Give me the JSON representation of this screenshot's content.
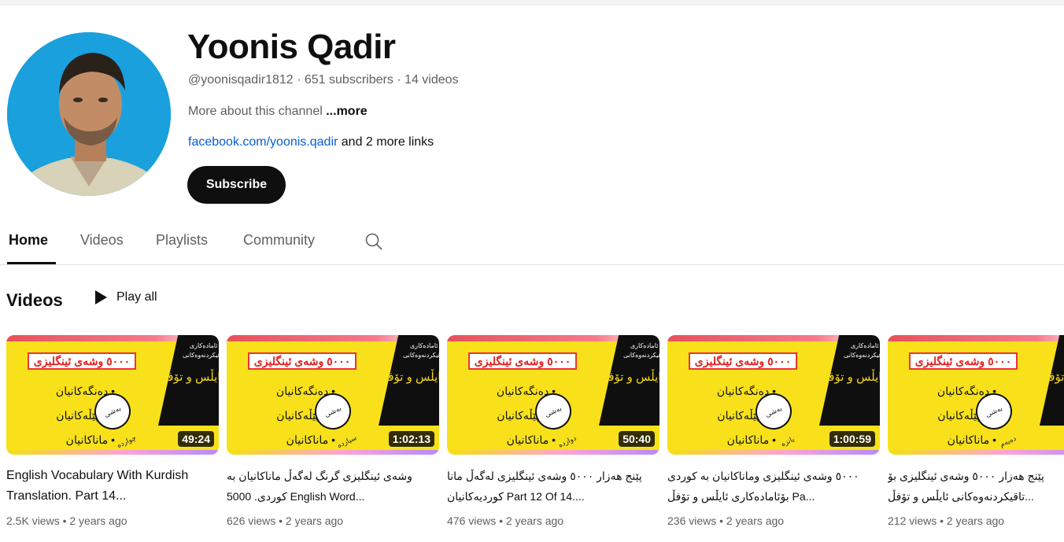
{
  "channel": {
    "name": "Yoonis Qadir",
    "meta": "@yoonisqadir1812 · 651 subscribers · 14 videos",
    "about_text": "More about this channel",
    "about_more": "...more",
    "link": "facebook.com/yoonis.qadir",
    "link_suffix": "and 2 more links",
    "subscribe_label": "Subscribe"
  },
  "tabs": [
    {
      "label": "Home",
      "active": true
    },
    {
      "label": "Videos"
    },
    {
      "label": "Playlists"
    },
    {
      "label": "Community"
    }
  ],
  "icons": {
    "search": "search-icon",
    "play": "play-icon"
  },
  "shelf": {
    "title": "Videos",
    "play_all": "Play all"
  },
  "thumb_text": {
    "heading": "٥٠٠٠ وشەی ئینگلیزی",
    "bullets": [
      "• دەنگەکانیان",
      "• سپێڵەکانیان",
      "• ماناکانیان"
    ],
    "right_top": "بۆ ئامادەکاری تاقیکردنەوەکانی",
    "right_main": "ئایڵس و تۆفڵ"
  },
  "videos": [
    {
      "badge": "بەشی چواردە",
      "duration": "49:24",
      "title": "English Vocabulary With Kurdish Translation. Part 14...",
      "rtl": false,
      "meta": "2.5K views • 2 years ago"
    },
    {
      "badge": "بەشی سیازدە",
      "duration": "1:02:13",
      "title": "وشەی ئینگلیزی گرنگ لەگەڵ ماناکانیان به کوردی. 5000 English Word...",
      "rtl": true,
      "meta": "626 views • 2 years ago"
    },
    {
      "badge": "بەشی دوازدە",
      "duration": "50:40",
      "title": "پێنج هەزار ٥٠٠٠ وشەی ئینگلیزی لەگەڵ مانا کوردیەکانیان Part 12 Of 14....",
      "rtl": true,
      "meta": "476 views • 2 years ago"
    },
    {
      "badge": "بەشی یانزە",
      "duration": "1:00:59",
      "title": "٥٠٠٠ وشەی ئینگلیزی وماناکانیان به کوردی بۆئامادەکاری ئایڵس و تۆفڵ Pa...",
      "rtl": true,
      "meta": "236 views • 2 years ago"
    },
    {
      "badge": "بەشی دەیەم",
      "duration": "",
      "title": "پێنج هەزار ٥٠٠٠ وشەی ئینگلیزی بۆ تاقیکردنەوەکانی ئایڵس و تۆفڵ...",
      "rtl": true,
      "meta": "212 views • 2 years ago"
    }
  ]
}
